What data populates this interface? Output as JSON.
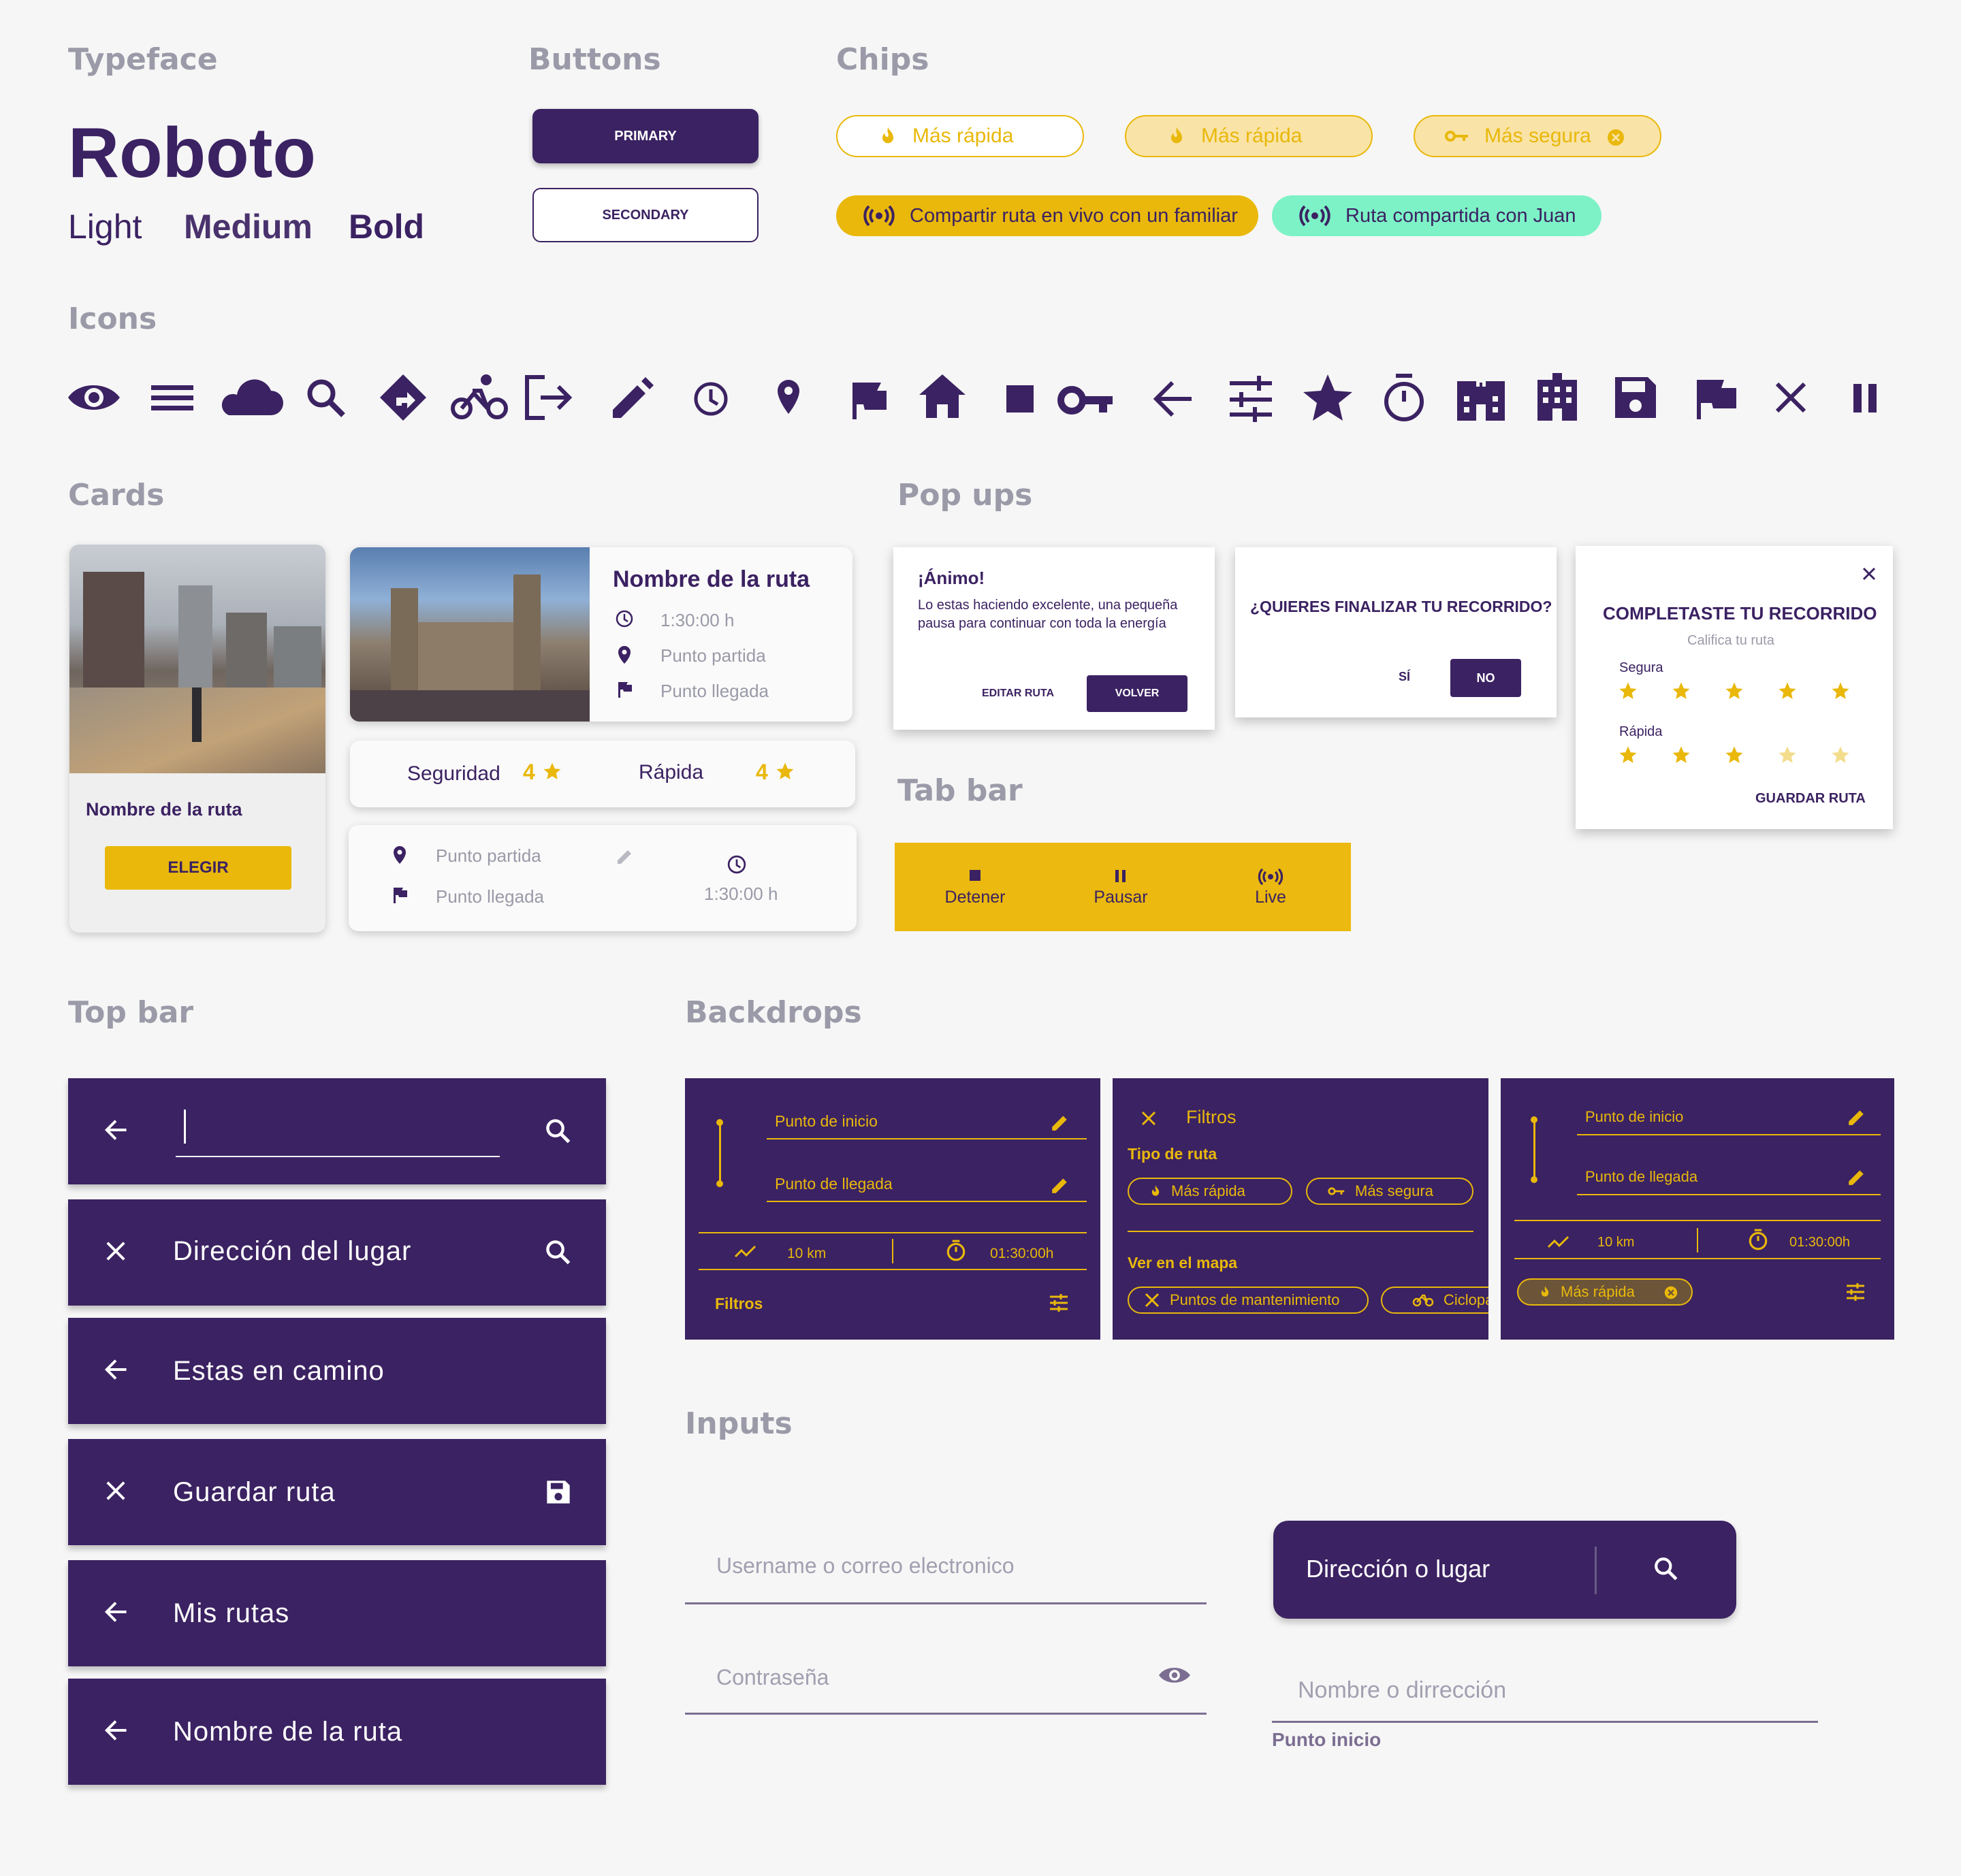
{
  "sections": {
    "typeface": "Typeface",
    "buttons": "Buttons",
    "chips": "Chips",
    "icons": "Icons",
    "cards": "Cards",
    "popups": "Pop ups",
    "tabbar": "Tab bar",
    "topbar": "Top bar",
    "backdrops": "Backdrops",
    "inputs": "Inputs"
  },
  "typeface": {
    "name": "Roboto",
    "light": "Light",
    "medium": "Medium",
    "bold": "Bold"
  },
  "buttons": {
    "primary": "PRIMARY",
    "secondary": "SECONDARY"
  },
  "chips": {
    "outline_fast": "Más rápida",
    "filled_fast": "Más rápida",
    "filled_safe": "Más segura",
    "share_live": "Compartir ruta en vivo con un familiar",
    "shared_with": "Ruta compartida con Juan"
  },
  "icons": [
    "eye-icon",
    "menu-icon",
    "cloud-icon",
    "search-icon",
    "directions-icon",
    "bike-icon",
    "exit-icon",
    "pencil-icon",
    "clock-icon",
    "pin-icon",
    "flag-icon",
    "home-icon",
    "stop-icon",
    "key-icon",
    "arrow-left-icon",
    "tune-icon",
    "star-icon",
    "timer-icon",
    "hospital-icon",
    "building-icon",
    "save-icon",
    "flag-outline-icon",
    "close-icon",
    "pause-icon"
  ],
  "cards": {
    "card1": {
      "title": "Nombre de la ruta",
      "button": "ELEGIR"
    },
    "card2": {
      "title": "Nombre de la ruta",
      "time": "1:30:00 h",
      "start": "Punto partida",
      "end": "Punto llegada"
    },
    "card3": {
      "label1": "Seguridad",
      "value1": "4",
      "label2": "Rápida",
      "value2": "4"
    },
    "card4": {
      "start": "Punto partida",
      "end": "Punto llegada",
      "time": "1:30:00 h"
    }
  },
  "popups": {
    "p1": {
      "title": "¡Ánimo!",
      "body": "Lo estas haciendo excelente, una pequeña pausa para continuar con toda la energía",
      "edit": "EDITAR RUTA",
      "back": "VOLVER"
    },
    "p2": {
      "title": "¿QUIERES FINALIZAR TU RECORRIDO?",
      "yes": "SÍ",
      "no": "NO"
    },
    "p3": {
      "title": "COMPLETASTE TU RECORRIDO",
      "subtitle": "Califica tu ruta",
      "safe": "Segura",
      "fast": "Rápida",
      "safe_rating": 5,
      "fast_rating": 3,
      "save": "GUARDAR RUTA"
    }
  },
  "tabbar": {
    "stop": "Detener",
    "pause": "Pausar",
    "live": "Live"
  },
  "topbars": {
    "t1": "",
    "t2": "Dirección del lugar",
    "t3": "Estas en camino",
    "t4": "Guardar ruta",
    "t5": "Mis rutas",
    "t6": "Nombre de la ruta"
  },
  "backdrops": {
    "b1": {
      "start": "Punto de inicio",
      "end": "Punto de llegada",
      "distance": "10 km",
      "time": "01:30:00h",
      "filters": "Filtros"
    },
    "b2": {
      "title": "Filtros",
      "route_type": "Tipo de ruta",
      "fast": "Más rápida",
      "safe": "Más segura",
      "map": "Ver en el mapa",
      "maint": "Puntos de mantenimiento",
      "bike": "Ciclopa"
    },
    "b3": {
      "start": "Punto de inicio",
      "end": "Punto de llegada",
      "distance": "10 km",
      "time": "01:30:00h",
      "chip": "Más rápida"
    }
  },
  "inputs": {
    "username": "Username o correo electronico",
    "password": "Contraseña",
    "search": "Dirección o lugar",
    "name": "Nombre o dirrección",
    "helper": "Punto inicio"
  },
  "colors": {
    "primary": "#3b2262",
    "accent": "#e9b80b",
    "mint": "#7df2c6",
    "bg": "#f6f6f6"
  }
}
